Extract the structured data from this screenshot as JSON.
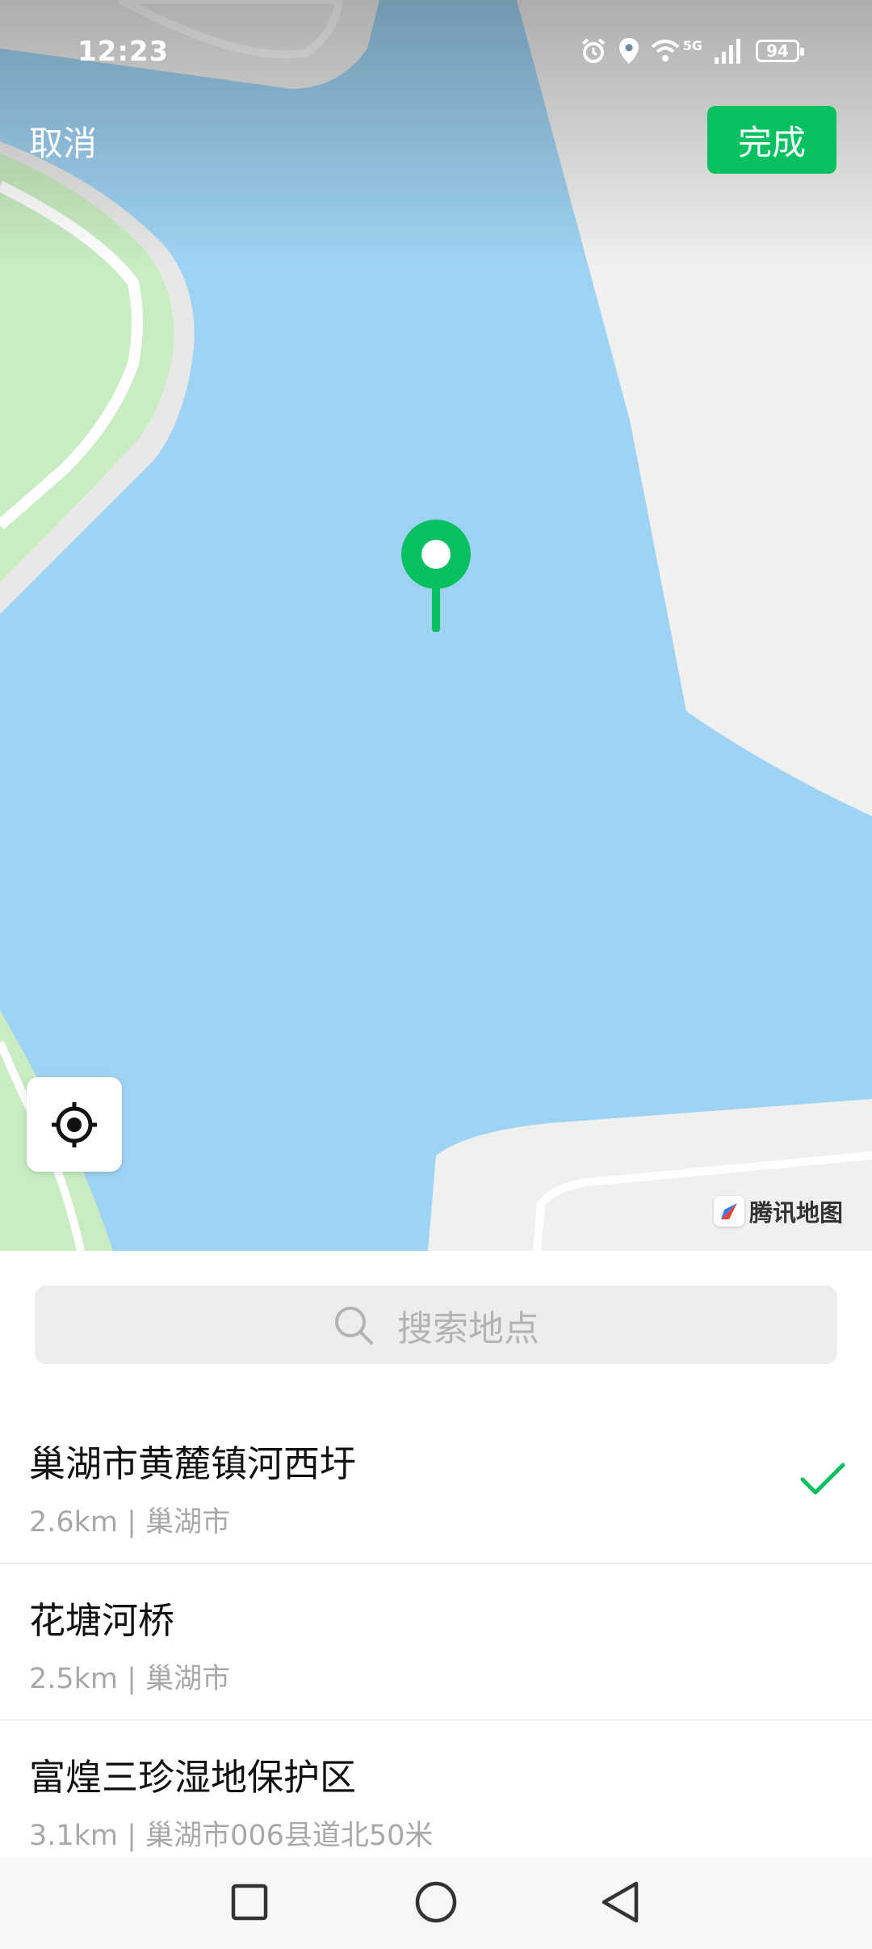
{
  "status_bar": {
    "time": "12:23",
    "network": "5G",
    "battery": "94",
    "icons": [
      "alarm-icon",
      "location-icon",
      "wifi-icon",
      "signal-icon",
      "battery-icon"
    ]
  },
  "header": {
    "cancel_label": "取消",
    "done_label": "完成"
  },
  "map": {
    "provider_label": "腾讯地图",
    "pin_color": "#07c160",
    "water_color": "#9fd3f4",
    "land_color": "#f0f0ee",
    "park_color": "#c9ecc2"
  },
  "search": {
    "placeholder": "搜索地点"
  },
  "results": [
    {
      "name": "巢湖市黄麓镇河西圩",
      "detail": "2.6km | 巢湖市",
      "selected": true
    },
    {
      "name": "花塘河桥",
      "detail": "2.5km | 巢湖市",
      "selected": false
    },
    {
      "name": "富煌三珍湿地保护区",
      "detail": "3.1km | 巢湖市006县道北50米",
      "selected": false
    }
  ],
  "colors": {
    "accent": "#07c160",
    "check": "#07c160"
  }
}
